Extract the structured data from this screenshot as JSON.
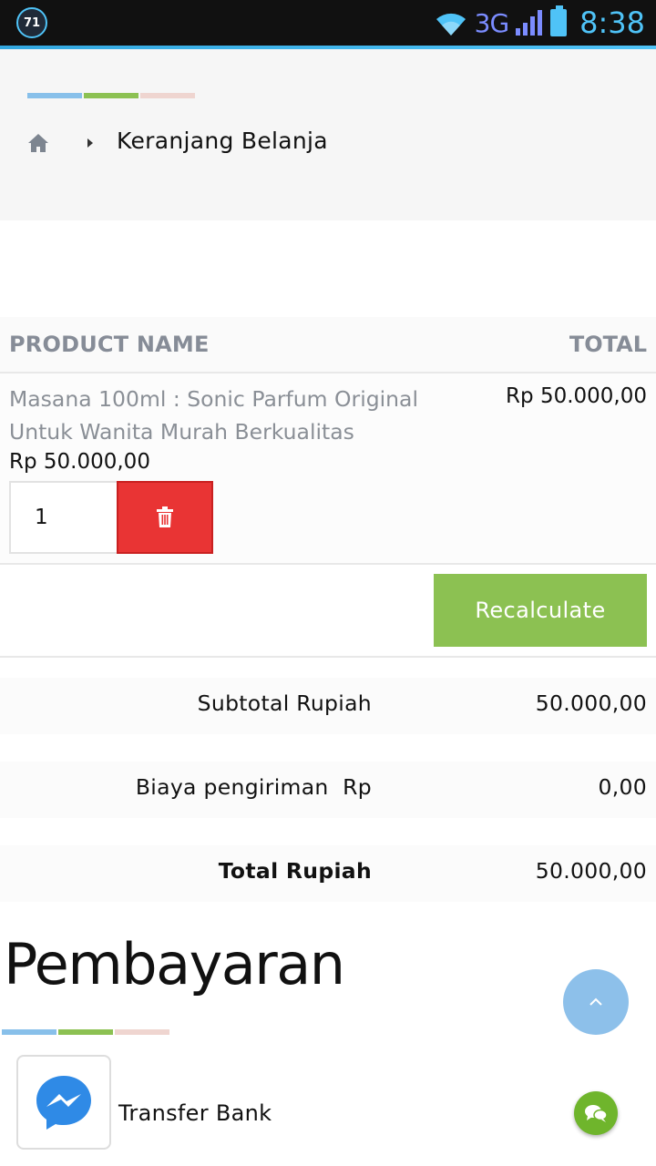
{
  "statusbar": {
    "badge": "71",
    "network": "3G",
    "time": "8:38"
  },
  "breadcrumb": {
    "current": "Keranjang Belanja"
  },
  "table": {
    "header_product": "PRODUCT NAME",
    "header_total": "TOTAL"
  },
  "item": {
    "name": "Masana 100ml : Sonic Parfum Original Untuk Wanita Murah Berkualitas",
    "price": "Rp 50.000,00",
    "total": "Rp 50.000,00",
    "quantity": "1"
  },
  "actions": {
    "recalculate": "Recalculate"
  },
  "summary": {
    "subtotal_label": "Subtotal Rupiah",
    "subtotal_value": "50.000,00",
    "shipping_label": "Biaya pengiriman  Rp",
    "shipping_value": "0,00",
    "total_label": "Total Rupiah",
    "total_value": "50.000,00"
  },
  "payment": {
    "title": "Pembayaran",
    "method": "Transfer Bank"
  },
  "colors": {
    "accent_blue": "#88c0ea",
    "accent_green": "#8cc152",
    "accent_pink": "#efd5d0",
    "danger": "#e93434"
  }
}
